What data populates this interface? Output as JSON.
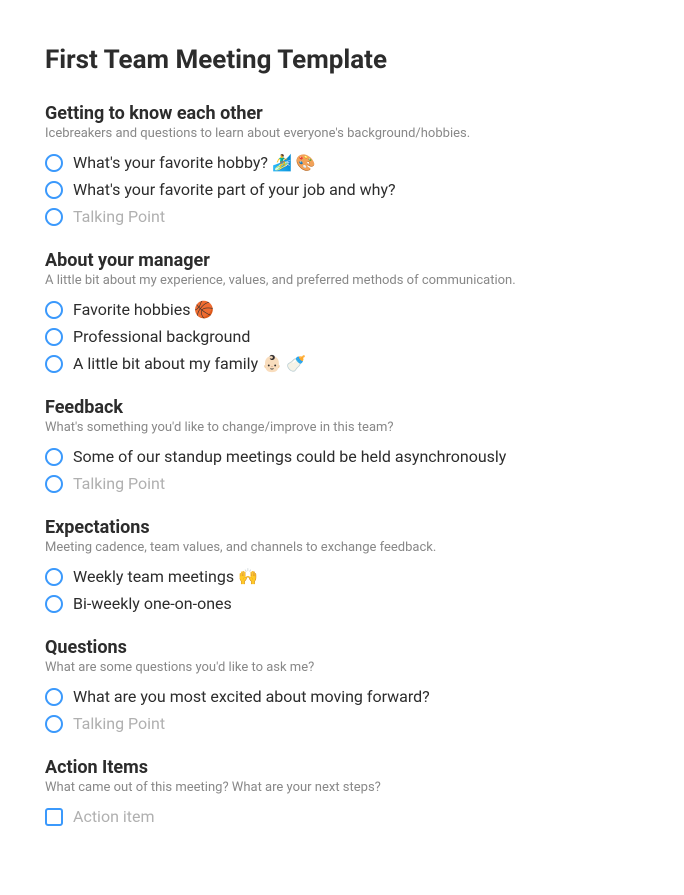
{
  "title": "First Team Meeting Template",
  "sections": [
    {
      "title": "Getting to know each other",
      "desc": "Icebreakers and questions to learn about everyone's background/hobbies.",
      "type": "radio",
      "items": [
        {
          "text": "What's your favorite hobby? 🏄‍♂️ 🎨",
          "placeholder": false
        },
        {
          "text": "What's your favorite part of your job and why?",
          "placeholder": false
        },
        {
          "text": "Talking Point",
          "placeholder": true
        }
      ]
    },
    {
      "title": "About your manager",
      "desc": "A little bit about my experience, values, and preferred methods of communication.",
      "type": "radio",
      "items": [
        {
          "text": "Favorite hobbies 🏀",
          "placeholder": false
        },
        {
          "text": "Professional background",
          "placeholder": false
        },
        {
          "text": "A little bit about my family 👶🏻 🍼",
          "placeholder": false
        }
      ]
    },
    {
      "title": "Feedback",
      "desc": "What's something you'd like to change/improve in this team?",
      "type": "radio",
      "items": [
        {
          "text": "Some of our standup meetings could be held asynchronously",
          "placeholder": false
        },
        {
          "text": "Talking Point",
          "placeholder": true
        }
      ]
    },
    {
      "title": "Expectations",
      "desc": "Meeting cadence, team values, and channels to exchange feedback.",
      "type": "radio",
      "items": [
        {
          "text": "Weekly team meetings 🙌",
          "placeholder": false
        },
        {
          "text": "Bi-weekly one-on-ones",
          "placeholder": false
        }
      ]
    },
    {
      "title": "Questions",
      "desc": "What are some questions you'd like to ask me?",
      "type": "radio",
      "items": [
        {
          "text": "What are you most excited about moving forward?",
          "placeholder": false
        },
        {
          "text": "Talking Point",
          "placeholder": true
        }
      ]
    },
    {
      "title": "Action Items",
      "desc": "What came out of this meeting? What are your next steps?",
      "type": "checkbox",
      "items": [
        {
          "text": "Action item",
          "placeholder": true
        }
      ]
    }
  ]
}
